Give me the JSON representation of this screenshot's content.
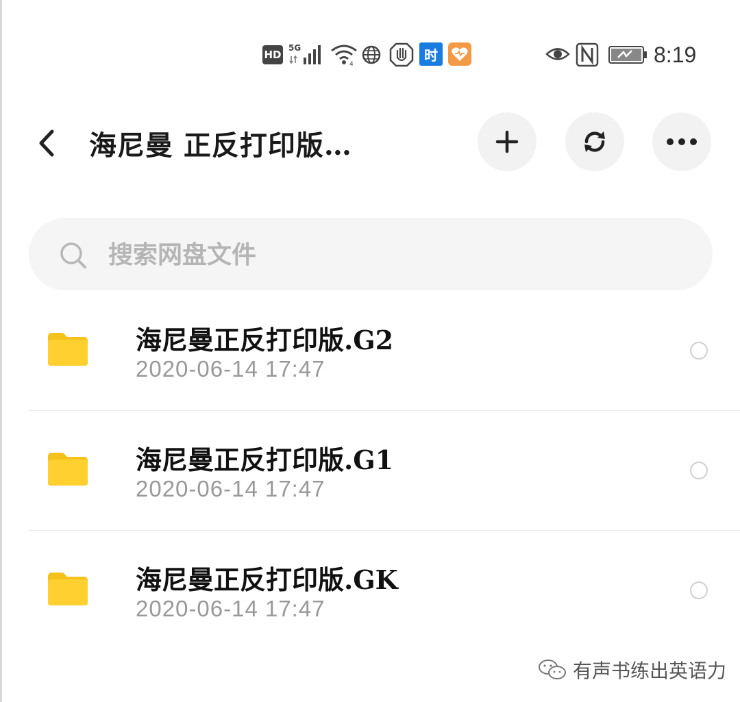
{
  "status_bar": {
    "hd": "HD",
    "network": "5G",
    "app_badge": "时",
    "time": "8:19",
    "icons": [
      "hd-icon",
      "signal-icon",
      "wifi-icon",
      "globe-icon",
      "hand-icon",
      "shi-app-icon",
      "heart-app-icon",
      "eye-icon",
      "nfc-icon",
      "battery-icon"
    ]
  },
  "header": {
    "title": "海尼曼  正反打印版…",
    "actions": [
      "add-button",
      "refresh-button",
      "more-button"
    ]
  },
  "search": {
    "placeholder": "搜索网盘文件"
  },
  "files": [
    {
      "name": "海尼曼正反打印版.G2",
      "date": "2020-06-14   17:47"
    },
    {
      "name": "海尼曼正反打印版.G1",
      "date": "2020-06-14   17:47"
    },
    {
      "name": "海尼曼正反打印版.GK",
      "date": "2020-06-14   17:47"
    }
  ],
  "watermark": {
    "text": "有声书练出英语力"
  },
  "colors": {
    "folder": "#FFD02F",
    "folder_tab": "#F5C21B",
    "button_bg": "#F2F2F2",
    "search_bg": "#F5F5F5"
  }
}
